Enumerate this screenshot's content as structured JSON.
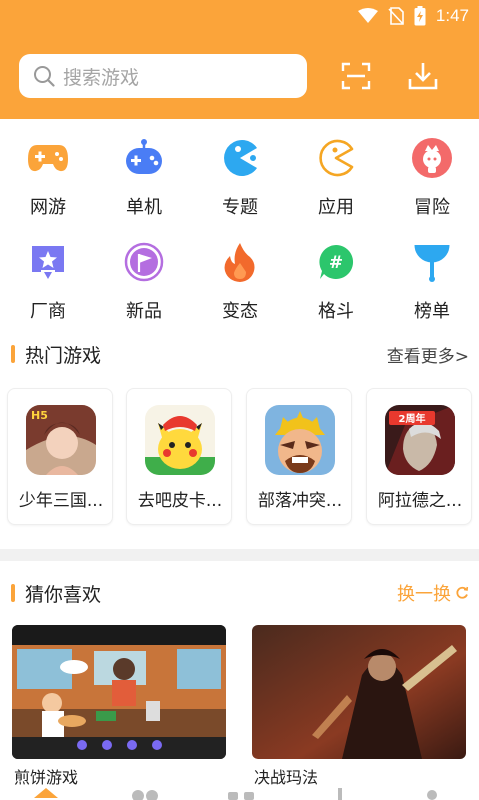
{
  "status": {
    "time": "1:47"
  },
  "search": {
    "placeholder": "搜索游戏"
  },
  "categories": [
    {
      "label": "网游",
      "icon": "gamepad-icon",
      "color": "#fba43a"
    },
    {
      "label": "单机",
      "icon": "controller-icon",
      "color": "#4a7df5"
    },
    {
      "label": "专题",
      "icon": "pacman-icon",
      "color": "#2da8f0"
    },
    {
      "label": "应用",
      "icon": "pacman-outline-icon",
      "color": "#f5a623"
    },
    {
      "label": "冒险",
      "icon": "character-icon",
      "color": "#f36a6a"
    },
    {
      "label": "厂商",
      "icon": "star-badge-icon",
      "color": "#7a78f2"
    },
    {
      "label": "新品",
      "icon": "flag-icon",
      "color": "#b46ee0"
    },
    {
      "label": "变态",
      "icon": "fire-icon",
      "color": "#f26a2c"
    },
    {
      "label": "格斗",
      "icon": "hash-chat-icon",
      "color": "#2cc66c"
    },
    {
      "label": "榜单",
      "icon": "ranking-icon",
      "color": "#2da8f0"
    }
  ],
  "hot": {
    "title": "热门游戏",
    "more": "查看更多>",
    "games": [
      {
        "name": "少年三国..."
      },
      {
        "name": "去吧皮卡..."
      },
      {
        "name": "部落冲突..."
      },
      {
        "name": "阿拉德之..."
      }
    ]
  },
  "recommend": {
    "title": "猜你喜欢",
    "refresh": "换一换",
    "items": [
      {
        "name": "煎饼游戏"
      },
      {
        "name": "决战玛法"
      }
    ]
  },
  "colors": {
    "accent": "#fba43a"
  }
}
